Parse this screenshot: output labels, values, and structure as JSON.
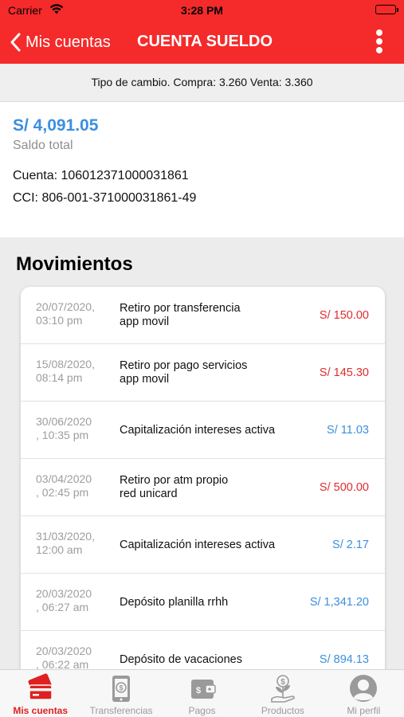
{
  "status_bar": {
    "carrier": "Carrier",
    "time": "3:28 PM"
  },
  "nav": {
    "back_label": "Mis cuentas",
    "title": "CUENTA SUELDO"
  },
  "exchange_rate": {
    "text": "Tipo de cambio. Compra: 3.260 Venta: 3.360"
  },
  "account": {
    "balance": "S/ 4,091.05",
    "balance_label": "Saldo total",
    "number": "Cuenta: 106012371000031861",
    "cci": "CCI: 806-001-371000031861-49"
  },
  "movements": {
    "title": "Movimientos",
    "items": [
      {
        "date": "20/07/2020,\n03:10 pm",
        "description": "Retiro por transferencia\napp movil",
        "amount": "S/ 150.00",
        "type": "debit"
      },
      {
        "date": "15/08/2020,\n08:14 pm",
        "description": "Retiro por pago servicios\napp movil",
        "amount": "S/ 145.30",
        "type": "debit"
      },
      {
        "date": "30/06/2020\n, 10:35 pm",
        "description": "Capitalización intereses activa",
        "amount": "S/ 11.03",
        "type": "credit"
      },
      {
        "date": "03/04/2020\n, 02:45 pm",
        "description": "Retiro por atm propio\nred unicard",
        "amount": "S/ 500.00",
        "type": "debit"
      },
      {
        "date": "31/03/2020,\n12:00 am",
        "description": "Capitalización intereses activa",
        "amount": "S/ 2.17",
        "type": "credit"
      },
      {
        "date": "20/03/2020\n, 06:27 am",
        "description": "Depósito planilla rrhh",
        "amount": "S/ 1,341.20",
        "type": "credit"
      },
      {
        "date": "20/03/2020\n, 06:22 am",
        "description": "Depósito de vacaciones",
        "amount": "S/ 894.13",
        "type": "credit"
      }
    ]
  },
  "tabs": [
    {
      "label": "Mis cuentas",
      "icon": "cards-icon",
      "active": true
    },
    {
      "label": "Transferencias",
      "icon": "phone-transfer-icon",
      "active": false
    },
    {
      "label": "Pagos",
      "icon": "wallet-icon",
      "active": false
    },
    {
      "label": "Productos",
      "icon": "money-plant-icon",
      "active": false
    },
    {
      "label": "Mi perfil",
      "icon": "user-avatar-icon",
      "active": false
    }
  ],
  "colors": {
    "brand_red": "#f52a2a",
    "debit": "#e22b2b",
    "credit": "#3c8fe0",
    "tab_inactive": "#9a9a9a"
  }
}
